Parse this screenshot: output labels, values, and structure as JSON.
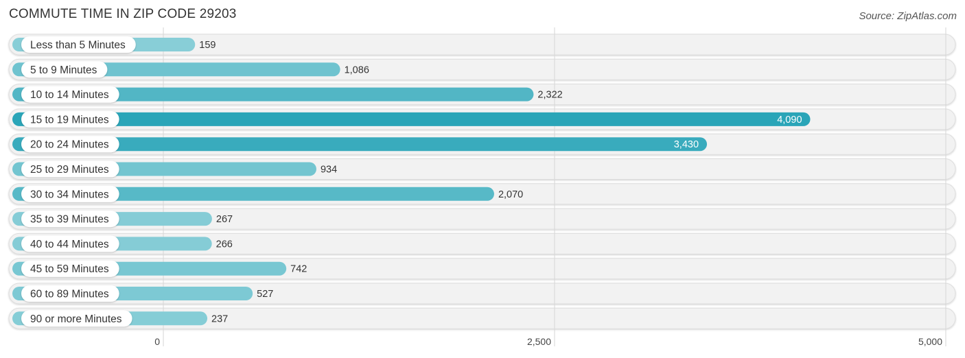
{
  "header": {
    "title": "COMMUTE TIME IN ZIP CODE 29203",
    "source": "Source: ZipAtlas.com"
  },
  "chart_data": {
    "type": "bar",
    "orientation": "horizontal",
    "title": "COMMUTE TIME IN ZIP CODE 29203",
    "xlabel": "",
    "ylabel": "",
    "xlim": [
      0,
      5000
    ],
    "xticks": [
      0,
      2500,
      5000
    ],
    "xtick_labels": [
      "0",
      "2,500",
      "5,000"
    ],
    "grid": true,
    "categories": [
      "Less than 5 Minutes",
      "5 to 9 Minutes",
      "10 to 14 Minutes",
      "15 to 19 Minutes",
      "20 to 24 Minutes",
      "25 to 29 Minutes",
      "30 to 34 Minutes",
      "35 to 39 Minutes",
      "40 to 44 Minutes",
      "45 to 59 Minutes",
      "60 to 89 Minutes",
      "90 or more Minutes"
    ],
    "values": [
      159,
      1086,
      2322,
      4090,
      3430,
      934,
      2070,
      267,
      266,
      742,
      527,
      237
    ],
    "value_labels": [
      "159",
      "1,086",
      "2,322",
      "4,090",
      "3,430",
      "934",
      "2,070",
      "267",
      "266",
      "742",
      "527",
      "237"
    ],
    "colors": {
      "bar_dark": "#2aa5b8",
      "bar_light": "#8dd0d9",
      "track": "#f2f2f2"
    }
  }
}
